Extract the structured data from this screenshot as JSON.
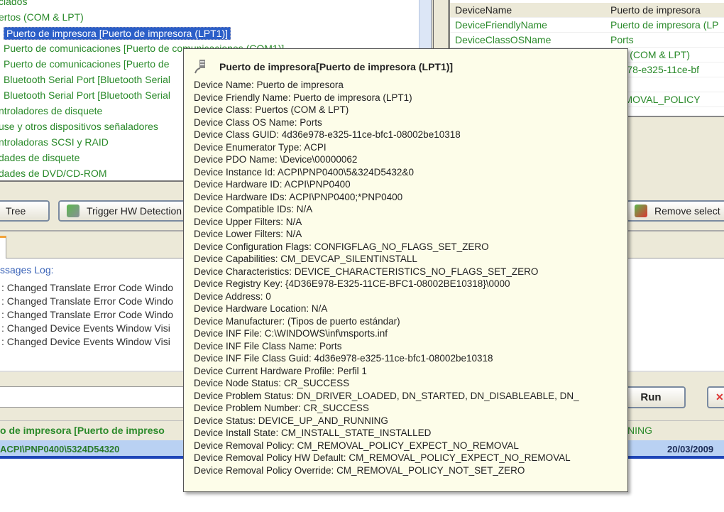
{
  "tree": {
    "items": [
      {
        "label": "clados"
      },
      {
        "label": "ertos (COM & LPT)"
      },
      {
        "label": "Puerto de impresora [Puerto de impresora (LPT1)]",
        "selected": true
      },
      {
        "label": "Puerto de comunicaciones [Puerto de comunicaciones (COM1)]"
      },
      {
        "label": "Puerto de comunicaciones [Puerto de"
      },
      {
        "label": "Bluetooth Serial Port [Bluetooth Serial"
      },
      {
        "label": "Bluetooth Serial Port [Bluetooth Serial"
      },
      {
        "label": "ntroladores de disquete"
      },
      {
        "label": "use y otros dispositivos señaladores"
      },
      {
        "label": "ntroladoras SCSI y RAID"
      },
      {
        "label": "dades de disquete"
      },
      {
        "label": "dades de DVD/CD-ROM"
      }
    ]
  },
  "properties": [
    {
      "key": "DeviceName",
      "value": "Puerto de impresora"
    },
    {
      "key": "DeviceFriendlyName",
      "value": "Puerto de impresora (LP"
    },
    {
      "key": "DeviceClassOSName",
      "value": "Ports"
    },
    {
      "key": "",
      "value": "rtos (COM & LPT)"
    },
    {
      "key": "",
      "value": "6e978-e325-11ce-bf"
    },
    {
      "key": "",
      "value": ""
    },
    {
      "key": "",
      "value": "REMOVAL_POLICY"
    }
  ],
  "toolbar": {
    "tree_label": "Tree",
    "trigger_label": "Trigger HW Detection",
    "remove_label": "Remove select"
  },
  "log": {
    "label": "ssages Log:",
    "lines": [
      ": Changed Translate Error Code Windo",
      ": Changed Translate Error Code Windo",
      ": Changed Translate Error Code Windo",
      ": Changed Device Events Window Visi",
      ": Changed Device Events Window Visi"
    ]
  },
  "run_label": "Run",
  "status": {
    "left": "o de impresora [Puerto de impreso",
    "right": "NING"
  },
  "bluebar": {
    "left": "ACPI\\PNP0400\\5324D54320",
    "date": "20/03/2009"
  },
  "tooltip": {
    "title": "Puerto de impresora[Puerto de impresora (LPT1)]",
    "lines": [
      "Device Name: Puerto de impresora",
      "Device Friendly Name: Puerto de impresora (LPT1)",
      "Device Class: Puertos (COM & LPT)",
      "Device Class OS Name: Ports",
      "Device Class GUID: 4d36e978-e325-11ce-bfc1-08002be10318",
      "Device Enumerator Type: ACPI",
      "Device PDO Name: \\Device\\00000062",
      "Device Instance Id: ACPI\\PNP0400\\5&324D5432&0",
      "Device Hardware ID: ACPI\\PNP0400",
      "Device Hardware IDs: ACPI\\PNP0400;*PNP0400",
      "Device Compatible IDs: N/A",
      "Device Upper Filters: N/A",
      "Device Lower Filters: N/A",
      "Device Configuration Flags: CONFIGFLAG_NO_FLAGS_SET_ZERO",
      "Device Capabilities: CM_DEVCAP_SILENTINSTALL",
      "Device Characteristics: DEVICE_CHARACTERISTICS_NO_FLAGS_SET_ZERO",
      "Device Registry Key: {4D36E978-E325-11CE-BFC1-08002BE10318}\\0000",
      "Device Address: 0",
      "Device Hardware Location: N/A",
      "Device Manufacturer: (Tipos de puerto estándar)",
      "Device INF File: C:\\WINDOWS\\inf\\msports.inf",
      "Device INF File Class Name: Ports",
      "Device INF File Class Guid: 4d36e978-e325-11ce-bfc1-08002be10318",
      "Device Current Hardware Profile: Perfil 1",
      "Device Node Status: CR_SUCCESS",
      "Device Problem Status: DN_DRIVER_LOADED, DN_STARTED, DN_DISABLEABLE, DN_",
      "Device Problem Number: CR_SUCCESS",
      "Device Status: DEVICE_UP_AND_RUNNING",
      "Device Install State: CM_INSTALL_STATE_INSTALLED",
      "Device Removal Policy: CM_REMOVAL_POLICY_EXPECT_NO_REMOVAL",
      "Device Removal Policy HW Default: CM_REMOVAL_POLICY_EXPECT_NO_REMOVAL",
      "Device Removal Policy Override: CM_REMOVAL_POLICY_NOT_SET_ZERO"
    ]
  }
}
